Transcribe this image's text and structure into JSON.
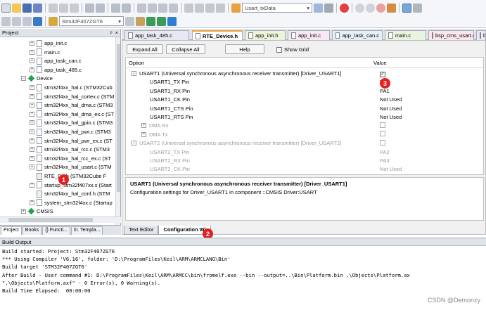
{
  "toolbar": {
    "target_select": "Usart_txData",
    "project_select": "Stm32F407ZGT6"
  },
  "project_panel": {
    "title": "Project",
    "pin_icon": "ᵖ",
    "close_icon": "×",
    "items": [
      {
        "label": "app_init.c",
        "type": "file"
      },
      {
        "label": "main.c",
        "type": "file"
      },
      {
        "label": "app_task_can.c",
        "type": "file"
      },
      {
        "label": "app_task_485.c",
        "type": "file"
      },
      {
        "label": "Device",
        "type": "group"
      },
      {
        "label": "stm32f4xx_hal.c (STM32Cub",
        "type": "file"
      },
      {
        "label": "stm32f4xx_hal_cortex.c (STM",
        "type": "file"
      },
      {
        "label": "stm32f4xx_hal_dma.c (STM3",
        "type": "file"
      },
      {
        "label": "stm32f4xx_hal_dma_ex.c (ST",
        "type": "file"
      },
      {
        "label": "stm32f4xx_hal_gpio.c (STM3",
        "type": "file"
      },
      {
        "label": "stm32f4xx_hal_pwr.c (STM3",
        "type": "file"
      },
      {
        "label": "stm32f4xx_hal_pwr_ex.c (ST",
        "type": "file"
      },
      {
        "label": "stm32f4xx_hal_rcc.c (STM3",
        "type": "file"
      },
      {
        "label": "stm32f4xx_hal_rcc_ex.c (ST",
        "type": "file"
      },
      {
        "label": "stm32f4xx_hal_usart.c (STM",
        "type": "file"
      },
      {
        "label": "RTE_De        h (STM32Cube F",
        "type": "cfg"
      },
      {
        "label": "startup_stm32f407xx.s (Start",
        "type": "file"
      },
      {
        "label": "stm32f4xx_hal_conf.h (STM",
        "type": "hdr"
      },
      {
        "label": "system_stm32f4xx.c (Startup",
        "type": "file"
      },
      {
        "label": "CMSIS",
        "type": "group"
      }
    ],
    "tabs": [
      "Project",
      "Books",
      "{} Functi...",
      "0↓ Templa..."
    ]
  },
  "editor_tabs": [
    {
      "label": "app_task_485.c",
      "active": false,
      "color": "#e8e8f4"
    },
    {
      "label": "RTE_Device.h",
      "active": true,
      "color": "#ffffff"
    },
    {
      "label": "app_init.h",
      "active": false,
      "color": "#eef4dc"
    },
    {
      "label": "app_init.c",
      "active": false,
      "color": "#f8e8f4"
    },
    {
      "label": "app_task_can.c",
      "active": false,
      "color": "#e4f0f8"
    },
    {
      "label": "main.c",
      "active": false,
      "color": "#e8f4e0"
    },
    {
      "label": "bsp_cms_usart.c",
      "active": false,
      "color": "#fbe6ec"
    },
    {
      "label": "bsp_",
      "active": false,
      "color": "#ece8f8"
    }
  ],
  "config": {
    "expand_all": "Expand All",
    "collapse_all": "Collapse All",
    "help": "Help",
    "show_grid": "Show Grid",
    "col_option": "Option",
    "col_value": "Value",
    "rows": [
      {
        "label": "USART1 (Universal synchronous asynchronous receiver transmitter) [Driver_USART1]",
        "value": "☑",
        "level": 0,
        "state": "expanded",
        "grey": false
      },
      {
        "label": "USART1_TX Pin",
        "value": "PA9",
        "level": 1,
        "state": "leaf",
        "grey": false
      },
      {
        "label": "USART1_RX Pin",
        "value": "PA1",
        "level": 1,
        "state": "leaf",
        "grey": false
      },
      {
        "label": "USART1_CK Pin",
        "value": "Not Used",
        "level": 1,
        "state": "leaf",
        "grey": false
      },
      {
        "label": "USART1_CTS Pin",
        "value": "Not Used",
        "level": 1,
        "state": "leaf",
        "grey": false
      },
      {
        "label": "USART1_RTS Pin",
        "value": "Not Used",
        "level": 1,
        "state": "leaf",
        "grey": false
      },
      {
        "label": "DMA Rx",
        "value": "☐",
        "level": 1,
        "state": "collapsed",
        "grey": true
      },
      {
        "label": "DMA Tx",
        "value": "☐",
        "level": 1,
        "state": "collapsed",
        "grey": true
      },
      {
        "label": "USART2 (Universal synchronous asynchronous receiver transmitter) [Driver_USART2]",
        "value": "☐",
        "level": 0,
        "state": "expanded",
        "grey": true
      },
      {
        "label": "USART2_TX Pin",
        "value": "PA2",
        "level": 1,
        "state": "leaf",
        "grey": true
      },
      {
        "label": "USART2_RX Pin",
        "value": "PA3",
        "level": 1,
        "state": "leaf",
        "grey": true
      },
      {
        "label": "USART2_CK Pin",
        "value": "Not Used",
        "level": 1,
        "state": "leaf",
        "grey": true
      }
    ],
    "desc_title": "USART1 (Universal synchronous asynchronous receiver transmitter) [Driver_USART1]",
    "desc_text": "Configuration settings for Driver_USART1 in component ::CMSIS Driver:USART",
    "bottom_tabs": [
      "Text Editor",
      "Configuration Wi"
    ]
  },
  "callouts": [
    "1",
    "2",
    "3"
  ],
  "build_output": {
    "title": "Build Output",
    "lines": [
      "Build started: Project: Stm32F407ZGT6",
      "*** Using Compiler 'V6.16', folder: 'D:\\ProgramFiles\\Keil\\ARM\\ARMCLANG\\Bin'",
      "Build target 'STM32F407ZGT6'",
      "After Build - User command #1: D:\\ProgramFiles\\Keil\\ARM\\ARMCC\\bin\\fromelf.exe --bin --output=..\\Bin\\Platform.bin .\\Objects\\Platform.ax",
      "\".\\Objects\\Platform.axf\" - 0 Error(s), 0 Warning(s).",
      "Build Time Elapsed:  00:00:00"
    ]
  },
  "watermark": "CSDN @Demonzy"
}
